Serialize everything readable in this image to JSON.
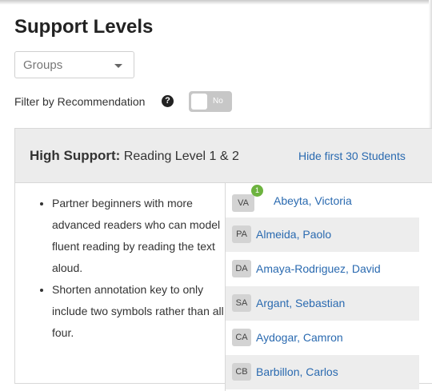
{
  "page_title": "Support Levels",
  "groups_select": {
    "value": "Groups"
  },
  "filter": {
    "label": "Filter by Recommendation",
    "help_icon": "question-circle-icon",
    "toggle_label": "No",
    "toggle_on": false
  },
  "panel": {
    "title_strong": "High Support:",
    "title_rest": " Reading Level 1 & 2",
    "hide_link": "Hide first 30 Students",
    "tips": [
      "Partner beginners with more advanced readers who can model fluent reading by reading the text aloud.",
      "Shorten annotation key to only include two symbols rather than all four."
    ],
    "students": [
      {
        "initials": "VA",
        "name": "Abeyta, Victoria",
        "recommendation_count": "1"
      },
      {
        "initials": "PA",
        "name": "Almeida, Paolo"
      },
      {
        "initials": "DA",
        "name": "Amaya-Rodriguez, David"
      },
      {
        "initials": "SA",
        "name": "Argant, Sebastian"
      },
      {
        "initials": "CA",
        "name": "Aydogar, Camron"
      },
      {
        "initials": "CB",
        "name": "Barbillon, Carlos"
      }
    ]
  },
  "colors": {
    "link": "#2a6ab0",
    "header_bg": "#ececec",
    "row_alt_bg": "#ededed",
    "recommendation_badge": "#6db33f",
    "toggle_off": "#c7c7c7"
  }
}
